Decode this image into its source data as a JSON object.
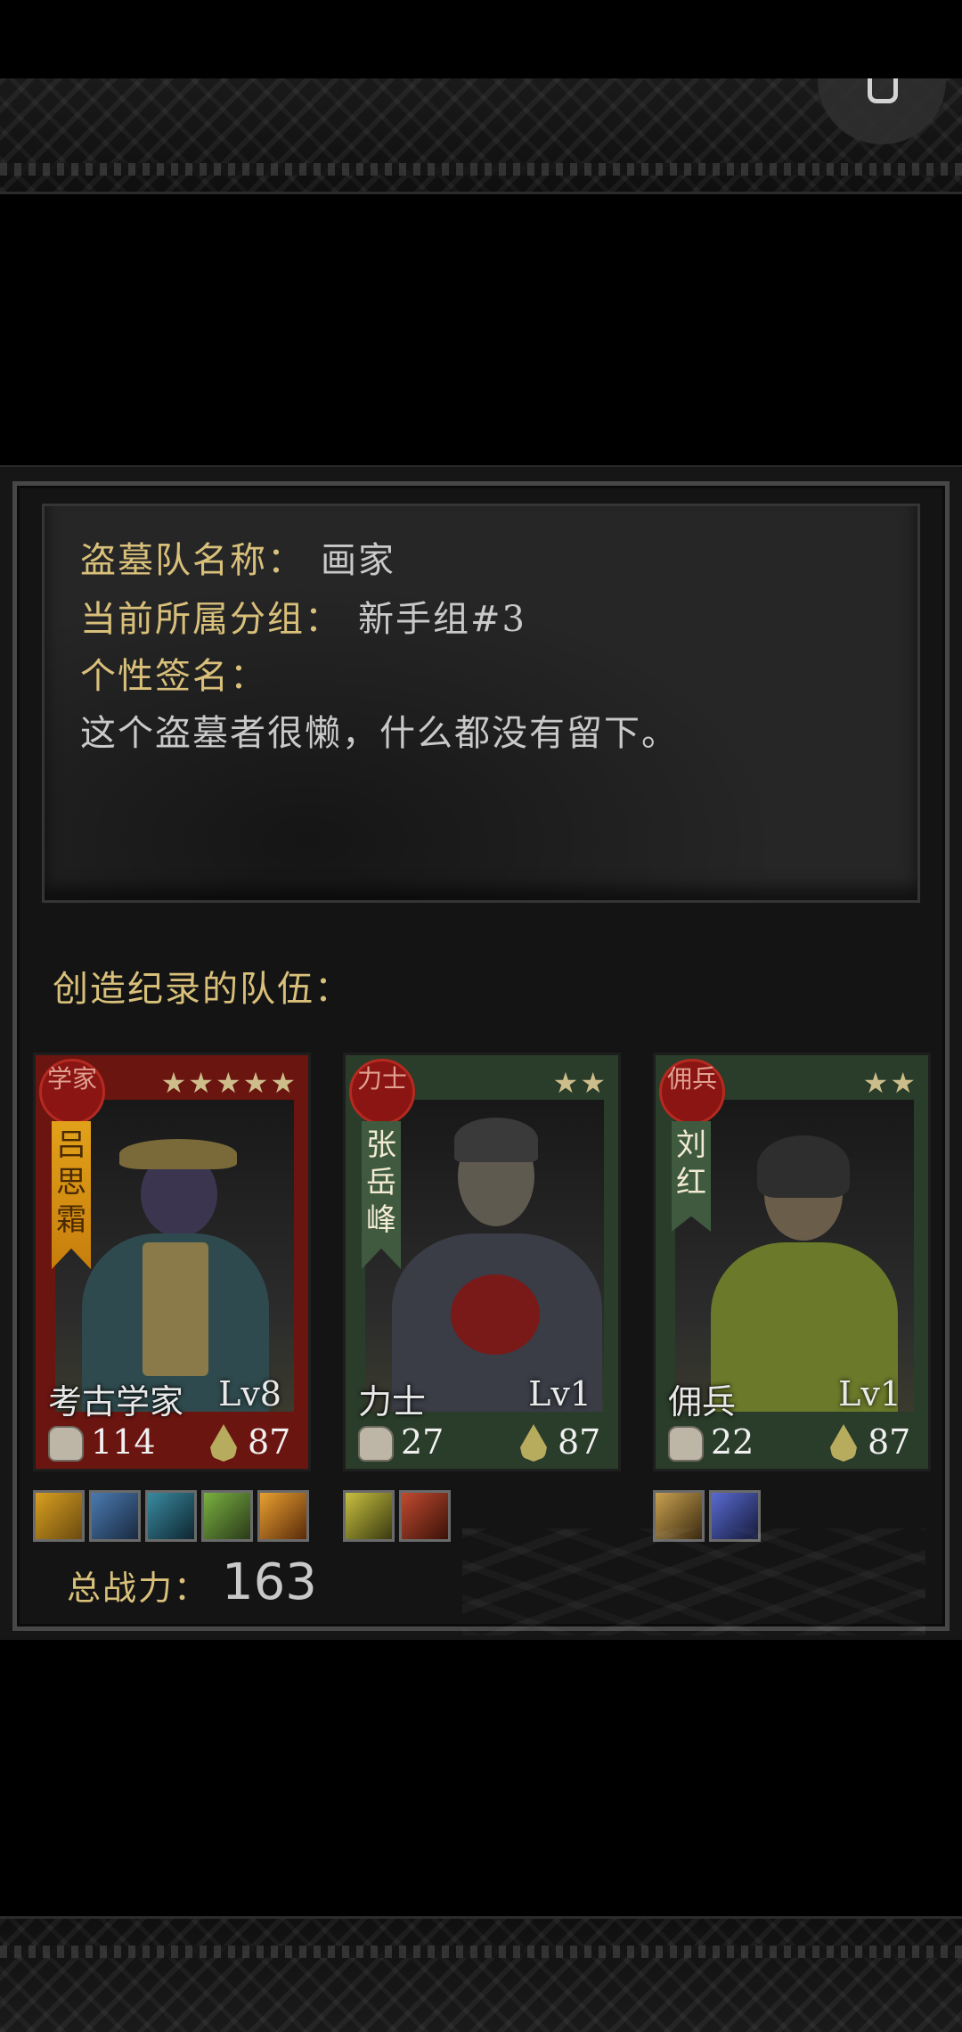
{
  "header": {
    "top_button_icon": "user-icon"
  },
  "info": {
    "team_name_label": "盗墓队名称：",
    "team_name_value": "画家",
    "group_label": "当前所属分组：",
    "group_value": "新手组#3",
    "signature_label": "个性签名：",
    "signature_value": "这个盗墓者很懒，什么都没有留下。"
  },
  "team": {
    "title": "创造纪录的队伍：",
    "heroes": [
      {
        "seal": "学家",
        "name": "吕思霜",
        "stars": "★★★★★",
        "class": "考古学家",
        "level": "Lv8",
        "power": "114",
        "stamina": "87",
        "theme": "red"
      },
      {
        "seal": "力士",
        "name": "张岳峰",
        "stars": "★★",
        "class": "力士",
        "level": "Lv1",
        "power": "27",
        "stamina": "87",
        "theme": "green"
      },
      {
        "seal": "佣兵",
        "name": "刘红",
        "stars": "★★",
        "class": "佣兵",
        "level": "Lv1",
        "power": "22",
        "stamina": "87",
        "theme": "green"
      }
    ]
  },
  "summary": {
    "power_label": "总战力：",
    "power_value": "163"
  },
  "colors": {
    "gold_text": "#d9c07a",
    "red_card": "#6b1511",
    "green_card": "#2a3c2a"
  }
}
